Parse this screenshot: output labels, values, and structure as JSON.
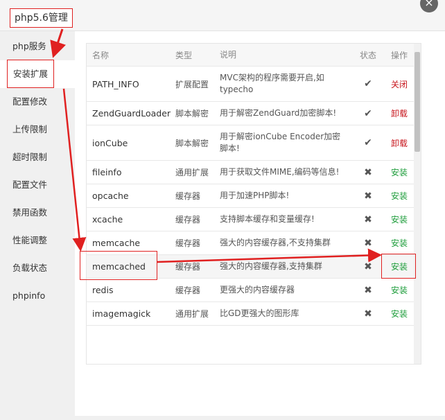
{
  "window": {
    "title": "php5.6管理",
    "close_glyph": "×"
  },
  "sidebar": {
    "items": [
      {
        "label": "php服务"
      },
      {
        "label": "安装扩展"
      },
      {
        "label": "配置修改"
      },
      {
        "label": "上传限制"
      },
      {
        "label": "超时限制"
      },
      {
        "label": "配置文件"
      },
      {
        "label": "禁用函数"
      },
      {
        "label": "性能调整"
      },
      {
        "label": "负载状态"
      },
      {
        "label": "phpinfo"
      }
    ],
    "active_index": 1
  },
  "table": {
    "headers": {
      "name": "名称",
      "type": "类型",
      "desc": "说明",
      "state": "状态",
      "op": "操作"
    },
    "rows": [
      {
        "name": "PATH_INFO",
        "type": "扩展配置",
        "desc": "MVC架构的程序需要开启,如typecho",
        "state": "✔",
        "op": "关闭",
        "op_color": "red"
      },
      {
        "name": "ZendGuardLoader",
        "type": "脚本解密",
        "desc": "用于解密ZendGuard加密脚本!",
        "state": "✔",
        "op": "卸载",
        "op_color": "red"
      },
      {
        "name": "ionCube",
        "type": "脚本解密",
        "desc": "用于解密ionCube Encoder加密脚本!",
        "state": "✔",
        "op": "卸载",
        "op_color": "red"
      },
      {
        "name": "fileinfo",
        "type": "通用扩展",
        "desc": "用于获取文件MIME,编码等信息!",
        "state": "✖",
        "op": "安装",
        "op_color": "green"
      },
      {
        "name": "opcache",
        "type": "缓存器",
        "desc": "用于加速PHP脚本!",
        "state": "✖",
        "op": "安装",
        "op_color": "green"
      },
      {
        "name": "xcache",
        "type": "缓存器",
        "desc": "支持脚本缓存和变量缓存!",
        "state": "✖",
        "op": "安装",
        "op_color": "green"
      },
      {
        "name": "memcache",
        "type": "缓存器",
        "desc": "强大的内容缓存器,不支持集群",
        "state": "✖",
        "op": "安装",
        "op_color": "green"
      },
      {
        "name": "memcached",
        "type": "缓存器",
        "desc": "强大的内容缓存器,支持集群",
        "state": "✖",
        "op": "安装",
        "op_color": "green"
      },
      {
        "name": "redis",
        "type": "缓存器",
        "desc": "更强大的内容缓存器",
        "state": "✖",
        "op": "安装",
        "op_color": "green"
      },
      {
        "name": "imagemagick",
        "type": "通用扩展",
        "desc": "比GD更强大的图形库",
        "state": "✖",
        "op": "安装",
        "op_color": "green"
      }
    ]
  },
  "colors": {
    "annotation_red": "#e02020",
    "op_red": "#c7161d",
    "op_green": "#1e9d3b"
  }
}
